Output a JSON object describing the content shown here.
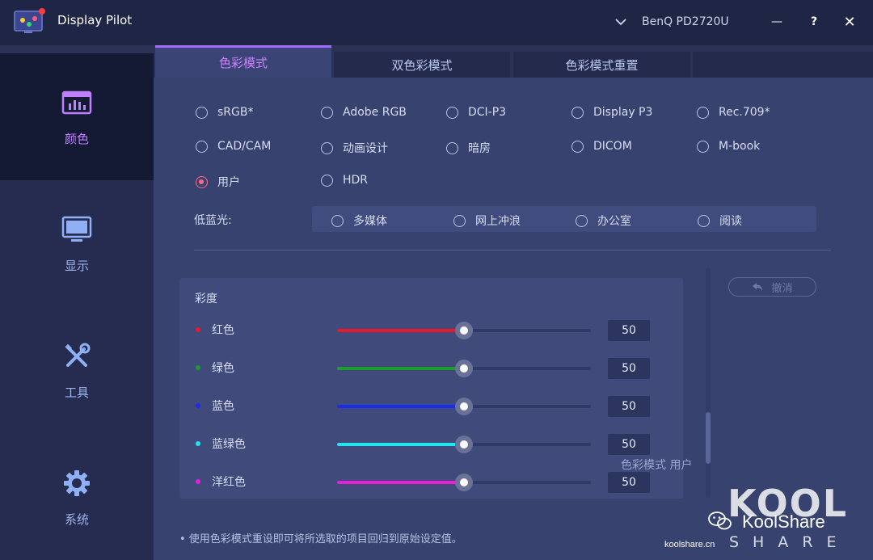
{
  "app": {
    "title": "Display Pilot",
    "monitor": "BenQ PD2720U",
    "window_buttons": {
      "minimize": "—",
      "help": "?",
      "close": "✕"
    }
  },
  "sidebar": {
    "items": [
      {
        "label": "颜色",
        "icon": "color-chart-icon",
        "active": true
      },
      {
        "label": "显示",
        "icon": "monitor-icon",
        "active": false
      },
      {
        "label": "工具",
        "icon": "tools-icon",
        "active": false
      },
      {
        "label": "系统",
        "icon": "gear-icon",
        "active": false
      }
    ]
  },
  "tabs": [
    {
      "label": "色彩模式",
      "active": true
    },
    {
      "label": "双色彩模式",
      "active": false
    },
    {
      "label": "色彩模式重置",
      "active": false
    },
    {
      "label": "",
      "active": false
    }
  ],
  "color_modes": {
    "options": [
      "sRGB*",
      "Adobe RGB",
      "DCI-P3",
      "Display P3",
      "Rec.709*",
      "CAD/CAM",
      "动画设计",
      "暗房",
      "DICOM",
      "M-book",
      "用户",
      "HDR"
    ],
    "selected": "用户"
  },
  "low_blue_light": {
    "label": "低蓝光:",
    "options": [
      "多媒体",
      "网上冲浪",
      "办公室",
      "阅读"
    ]
  },
  "saturation": {
    "title": "彩度",
    "rows": [
      {
        "name": "红色",
        "value": "50",
        "fraction": 0.5,
        "color": "#e8192c"
      },
      {
        "name": "绿色",
        "value": "50",
        "fraction": 0.5,
        "color": "#1f9a2e"
      },
      {
        "name": "蓝色",
        "value": "50",
        "fraction": 0.5,
        "color": "#1a2cf0"
      },
      {
        "name": "蓝绿色",
        "value": "50",
        "fraction": 0.5,
        "color": "#22e3f0"
      },
      {
        "name": "洋红色",
        "value": "50",
        "fraction": 0.5,
        "color": "#e81fd8"
      }
    ]
  },
  "undo": {
    "label": "撤消"
  },
  "footnote": "• 使用色彩模式重设即可将所选取的项目回归到原始设定值。",
  "watermark": {
    "brand": "KoolShare",
    "big": "KOOL",
    "sub": "SHARE",
    "site": "koolshare.cn",
    "behind_text": "色彩模式  用户"
  }
}
